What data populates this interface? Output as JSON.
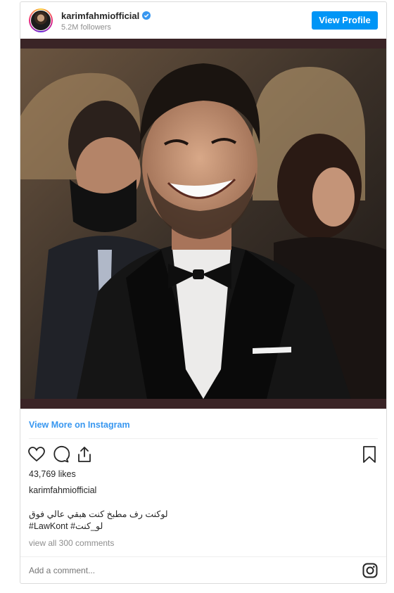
{
  "header": {
    "username": "karimfahmiofficial",
    "followers": "5.2M followers",
    "view_profile_label": "View Profile"
  },
  "post": {
    "view_more_label": "View More on Instagram",
    "likes": "43,769 likes",
    "caption_user": "karimfahmiofficial",
    "caption_line1": "لوكنت رف مطبخ كنت هبقي عالي فوق",
    "caption_line2": "#LawKont #لو_كنت",
    "view_comments": "view all 300 comments",
    "add_comment_placeholder": "Add a comment..."
  },
  "icons": [
    "verified-badge-icon",
    "heart-icon",
    "comment-icon",
    "share-icon",
    "bookmark-icon",
    "instagram-icon"
  ],
  "colors": {
    "accent": "#0095f6",
    "link": "#3897f0",
    "verified": "#3897f0"
  }
}
